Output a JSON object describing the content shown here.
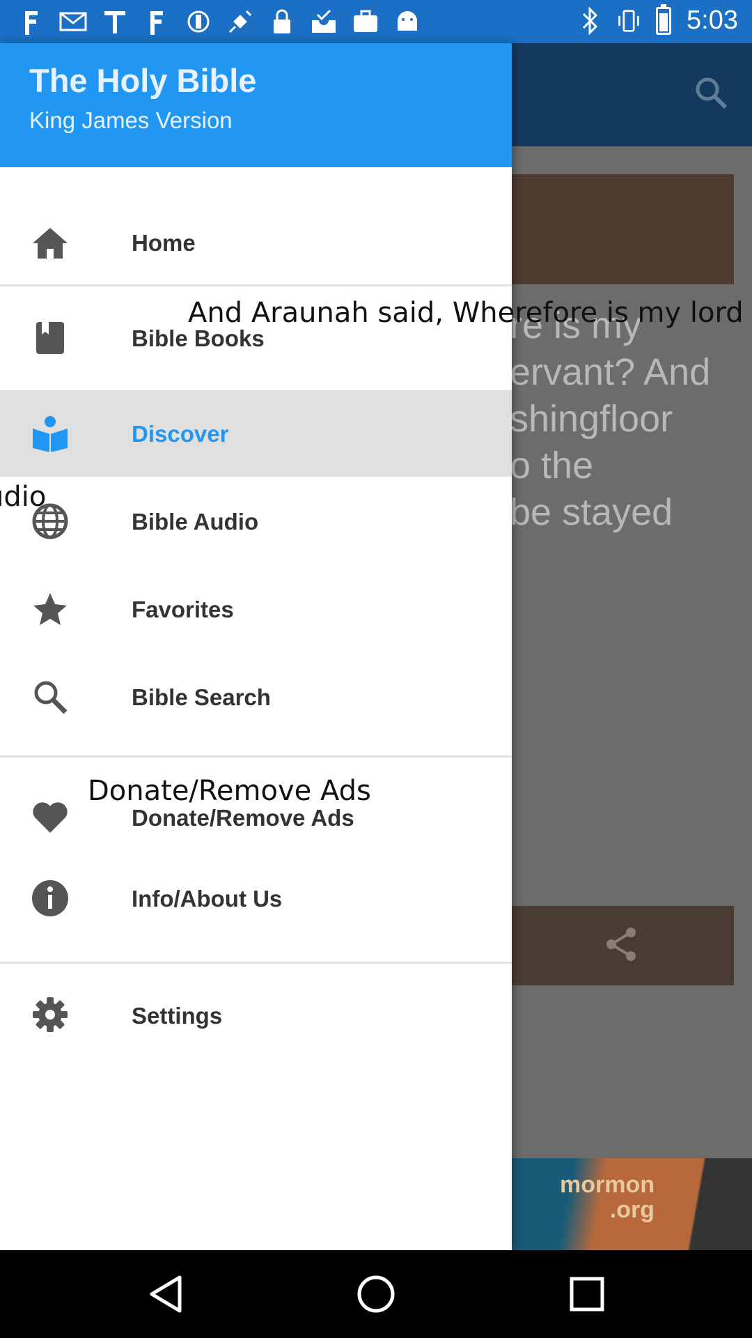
{
  "status_bar": {
    "time": "5:03",
    "left_icons": [
      "facebook-icon",
      "mail-icon",
      "text-icon",
      "facebook-icon",
      "cast-icon",
      "satellite-icon",
      "lock-icon",
      "inbox-check-icon",
      "briefcase-icon",
      "android-icon"
    ],
    "right_icons": [
      "bluetooth-icon",
      "vibrate-icon",
      "battery-icon"
    ]
  },
  "drawer": {
    "title": "The Holy Bible",
    "subtitle": "King James Version",
    "accent_color": "#2196f3",
    "items": [
      {
        "label": "Home",
        "icon": "home-icon"
      },
      {
        "label": "Bible Books",
        "icon": "book-icon"
      },
      {
        "label": "Discover",
        "icon": "open-book-icon",
        "selected": true
      },
      {
        "label": "Bible Audio",
        "icon": "globe-icon"
      },
      {
        "label": "Favorites",
        "icon": "star-icon"
      },
      {
        "label": "Bible Search",
        "icon": "search-icon"
      },
      {
        "label": "Donate/Remove Ads",
        "icon": "heart-icon"
      },
      {
        "label": "Info/About Us",
        "icon": "info-icon"
      },
      {
        "label": "Settings",
        "icon": "gear-icon"
      }
    ]
  },
  "background": {
    "verse_lines": [
      "re is my",
      "ervant? And",
      "shingfloor",
      "o the",
      "be stayed"
    ],
    "ad_text": "mormon\n.org"
  },
  "overlay": {
    "verse_caption": "And Araunah said, Wherefore is my lord th",
    "audio_fragment": "udio",
    "donate_caption": "Donate/Remove Ads"
  }
}
